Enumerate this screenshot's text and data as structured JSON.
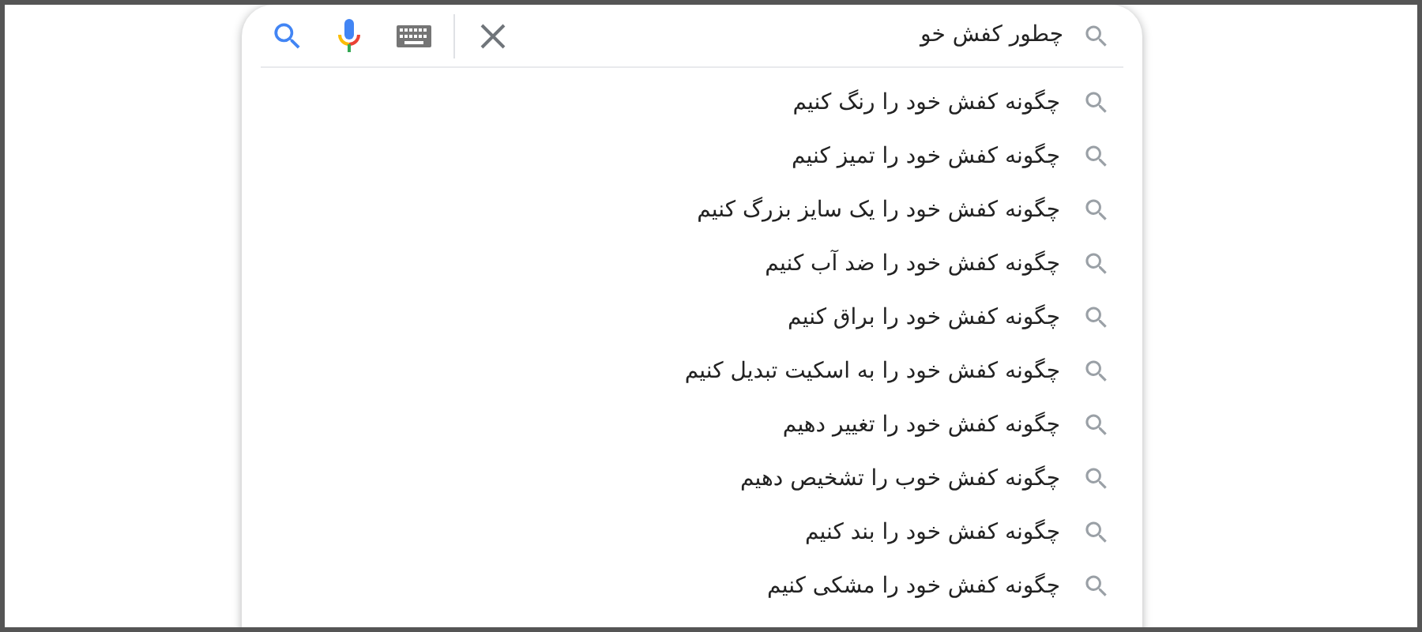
{
  "search": {
    "value": "چطور کفش خو"
  },
  "suggestions": [
    {
      "text": "چگونه کفش خود را رنگ کنیم"
    },
    {
      "text": "چگونه کفش خود را تمیز کنیم"
    },
    {
      "text": "چگونه کفش خود را یک سایز بزرگ کنیم"
    },
    {
      "text": "چگونه کفش خود را ضد آب کنیم"
    },
    {
      "text": "چگونه کفش خود را براق کنیم"
    },
    {
      "text": "چگونه کفش خود را به اسکیت تبدیل کنیم"
    },
    {
      "text": "چگونه کفش خود را تغییر دهیم"
    },
    {
      "text": "چگونه کفش خوب را تشخیص دهیم"
    },
    {
      "text": "چگونه کفش خود را بند کنیم"
    },
    {
      "text": "چگونه کفش خود را مشکی کنیم"
    }
  ]
}
